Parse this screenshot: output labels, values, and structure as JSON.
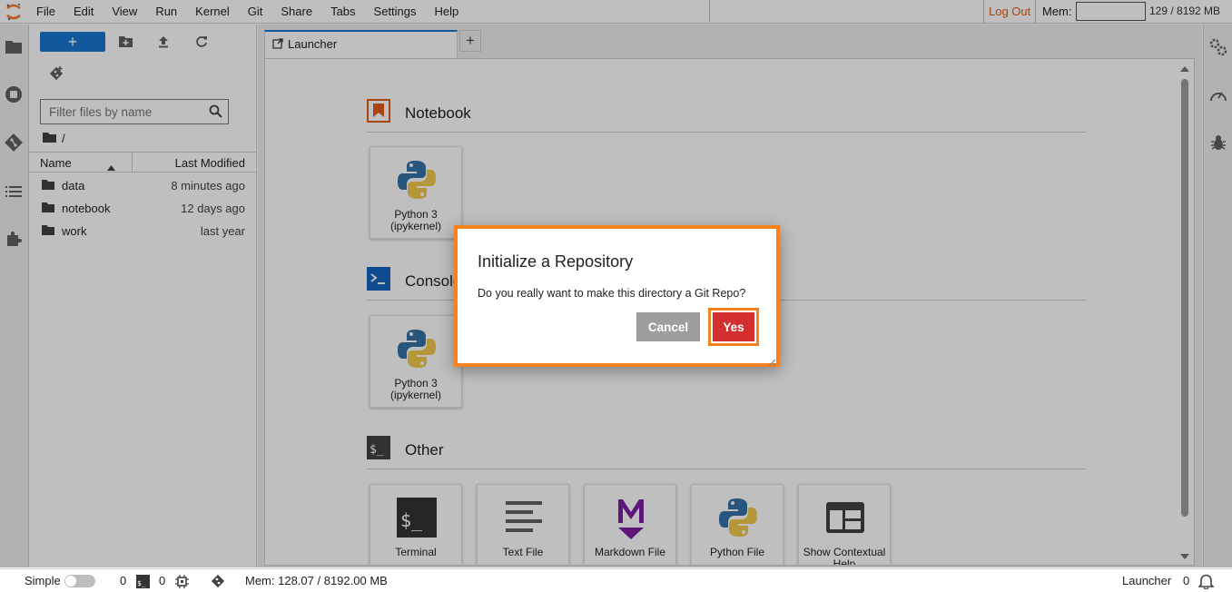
{
  "menubar": {
    "items": [
      "File",
      "Edit",
      "View",
      "Run",
      "Kernel",
      "Git",
      "Share",
      "Tabs",
      "Settings",
      "Help"
    ],
    "logout": "Log Out",
    "mem_label": "Mem:",
    "mem_value": "129 / 8192 MB"
  },
  "filebrowser": {
    "new_label": "+",
    "filter_placeholder": "Filter files by name",
    "breadcrumb": "/",
    "col_name": "Name",
    "col_modified": "Last Modified",
    "files": [
      {
        "name": "data",
        "modified": "8 minutes ago"
      },
      {
        "name": "notebook",
        "modified": "12 days ago"
      },
      {
        "name": "work",
        "modified": "last year"
      }
    ]
  },
  "tabs": {
    "active_label": "Launcher",
    "add_label": "+"
  },
  "launcher": {
    "sections": {
      "notebook": "Notebook",
      "console": "Console",
      "other": "Other"
    },
    "notebook_card": "Python 3 (ipykernel)",
    "console_card": "Python 3 (ipykernel)",
    "other_cards": [
      "Terminal",
      "Text File",
      "Markdown File",
      "Python File",
      "Show Contextual Help"
    ]
  },
  "dialog": {
    "title": "Initialize a Repository",
    "body": "Do you really want to make this directory a Git Repo?",
    "cancel": "Cancel",
    "yes": "Yes"
  },
  "statusbar": {
    "mode": "Simple",
    "terminals": "0",
    "kernels": "0",
    "memory": "Mem: 128.07 / 8192.00 MB",
    "launcher": "Launcher",
    "notifications": "0"
  },
  "colors": {
    "accent": "#1976d2",
    "highlight": "#f5821f",
    "yes_button": "#d32f2f",
    "logout": "#e35b18"
  }
}
